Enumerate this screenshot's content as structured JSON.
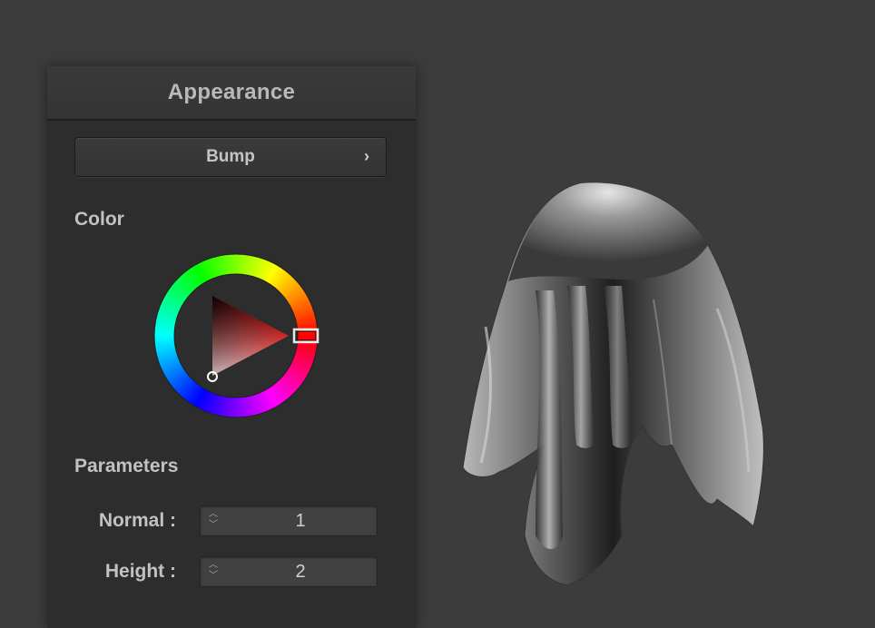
{
  "panel": {
    "title": "Appearance",
    "mode_button": {
      "label": "Bump",
      "chevron": "›"
    },
    "color_section": {
      "title": "Color",
      "selected_color": "#ff0000"
    },
    "parameters": {
      "title": "Parameters",
      "items": [
        {
          "label": "Normal :",
          "value": "1"
        },
        {
          "label": "Height :",
          "value": "2"
        }
      ]
    }
  },
  "colors": {
    "background": "#3c3c3c",
    "panel": "#2d2d2d",
    "text": "#c2c2c2"
  },
  "icons": {
    "spin_up": "chevron-up-icon",
    "spin_down": "chevron-down-icon",
    "mode_chevron": "chevron-right-icon"
  }
}
